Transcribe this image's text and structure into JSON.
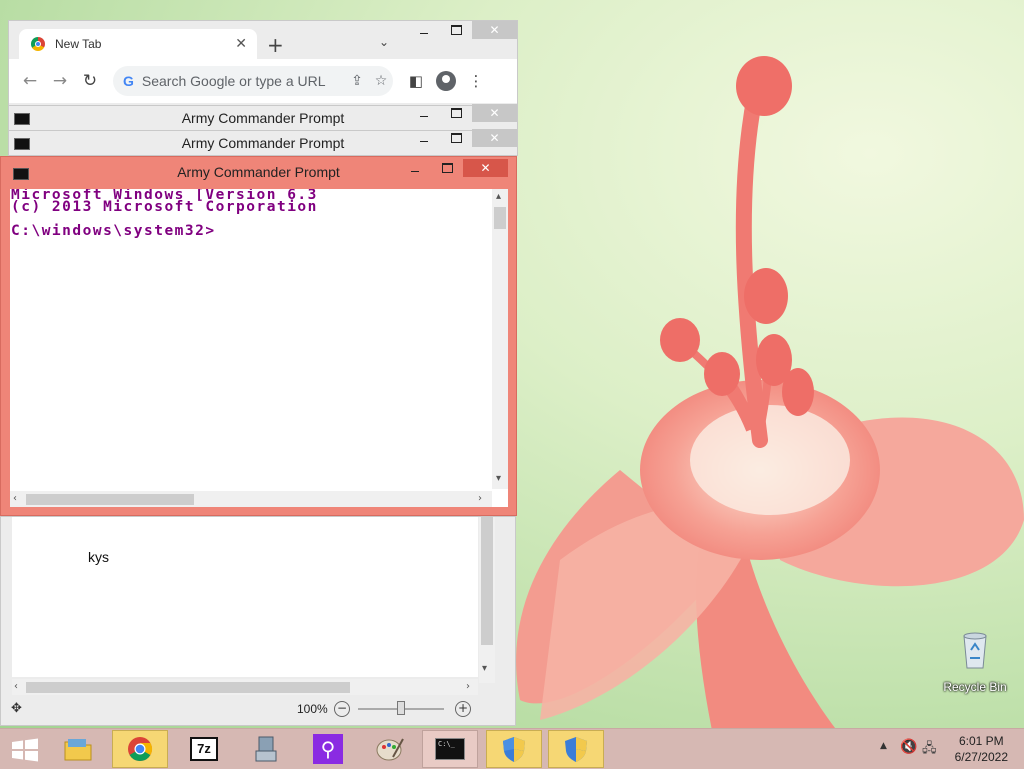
{
  "browser": {
    "tab_title": "New Tab",
    "omnibox_placeholder": "Search Google or type a URL"
  },
  "cmd_windows": [
    {
      "title": "Army Commander Prompt"
    },
    {
      "title": "Army Commander Prompt"
    }
  ],
  "active_cmd": {
    "title": "Army Commander Prompt",
    "lines": [
      "Microsoft Windows [Version 6.3",
      "(c) 2013 Microsoft Corporation",
      "",
      "C:\\windows\\system32>"
    ]
  },
  "document": {
    "text": "kys",
    "zoom": "100%"
  },
  "desktop": {
    "recycle_bin_label": "Recycle Bin"
  },
  "taskbar": {
    "items": [
      "file-explorer",
      "chrome",
      "7zip",
      "installer",
      "search-tool",
      "paint",
      "command-prompt",
      "uac-shield",
      "uac-shield"
    ],
    "clock_time": "6:01 PM",
    "clock_date": "6/27/2022"
  }
}
